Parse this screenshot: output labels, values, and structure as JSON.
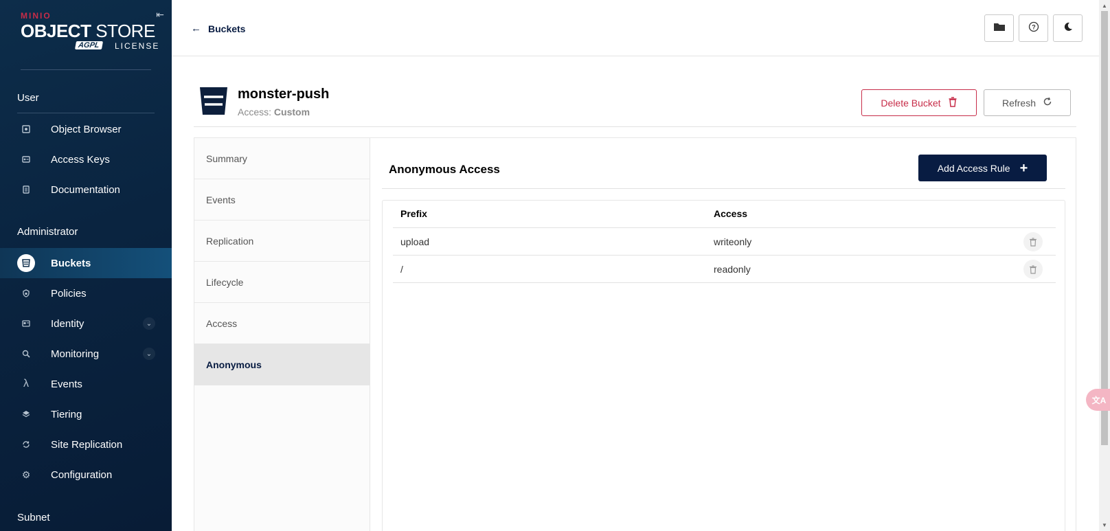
{
  "brand": {
    "minio": "MINIO",
    "product_bold": "OBJECT",
    "product_light": " STORE",
    "license_badge": "AGPL",
    "license_text": "LICENSE",
    "brand_color": "#c72c48"
  },
  "sidebar": {
    "user_section": "User",
    "user_items": [
      {
        "label": "Object Browser",
        "icon": "object-browser-icon"
      },
      {
        "label": "Access Keys",
        "icon": "key-card-icon"
      },
      {
        "label": "Documentation",
        "icon": "docs-icon"
      }
    ],
    "admin_section": "Administrator",
    "admin_items": [
      {
        "label": "Buckets",
        "icon": "bucket-icon",
        "active": true
      },
      {
        "label": "Policies",
        "icon": "shield-lock-icon"
      },
      {
        "label": "Identity",
        "icon": "id-card-icon",
        "expandable": true
      },
      {
        "label": "Monitoring",
        "icon": "magnifier-chart-icon",
        "expandable": true
      },
      {
        "label": "Events",
        "icon": "lambda-icon"
      },
      {
        "label": "Tiering",
        "icon": "layers-icon"
      },
      {
        "label": "Site Replication",
        "icon": "sync-icon"
      },
      {
        "label": "Configuration",
        "icon": "gear-icon"
      }
    ],
    "subnet_section": "Subnet"
  },
  "topbar": {
    "back_label": "Buckets",
    "buttons": [
      "folder-icon",
      "help-icon",
      "dark-mode-icon"
    ]
  },
  "bucket": {
    "name": "monster-push",
    "access_label": "Access: ",
    "access_value": "Custom",
    "delete_label": "Delete Bucket",
    "refresh_label": "Refresh"
  },
  "tabs": [
    {
      "label": "Summary",
      "active": false
    },
    {
      "label": "Events",
      "active": false
    },
    {
      "label": "Replication",
      "active": false
    },
    {
      "label": "Lifecycle",
      "active": false
    },
    {
      "label": "Access",
      "active": false
    },
    {
      "label": "Anonymous",
      "active": true
    }
  ],
  "anonymous": {
    "title": "Anonymous Access",
    "add_label": "Add Access Rule",
    "columns": [
      "Prefix",
      "Access"
    ],
    "rows": [
      {
        "prefix": "upload",
        "access": "writeonly"
      },
      {
        "prefix": "/",
        "access": "readonly"
      }
    ]
  },
  "colors": {
    "sidebar_bg": "#0a2440",
    "primary": "#081c42",
    "danger": "#c72c48"
  }
}
